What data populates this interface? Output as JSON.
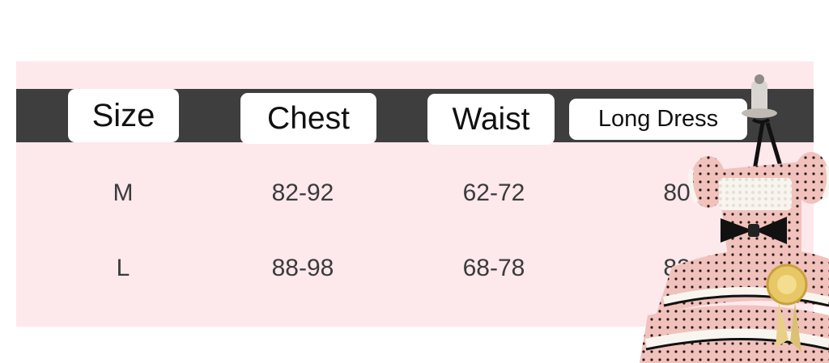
{
  "table": {
    "headers": [
      "Size",
      "Chest",
      "Waist",
      "Long Dress"
    ],
    "rows": [
      [
        "M",
        "82-92",
        "62-72",
        "80"
      ],
      [
        "L",
        "88-98",
        "68-78",
        "82"
      ]
    ]
  },
  "colors": {
    "panel_background": "#fde8ec",
    "header_bar": "#3e3e3e",
    "header_label_bg": "#ffffff",
    "text": "#3b3b3b"
  },
  "illustration": {
    "subject": "pink polka-dot lolita dress on mannequin with black bows, white lace trim and gold rosette badge"
  }
}
